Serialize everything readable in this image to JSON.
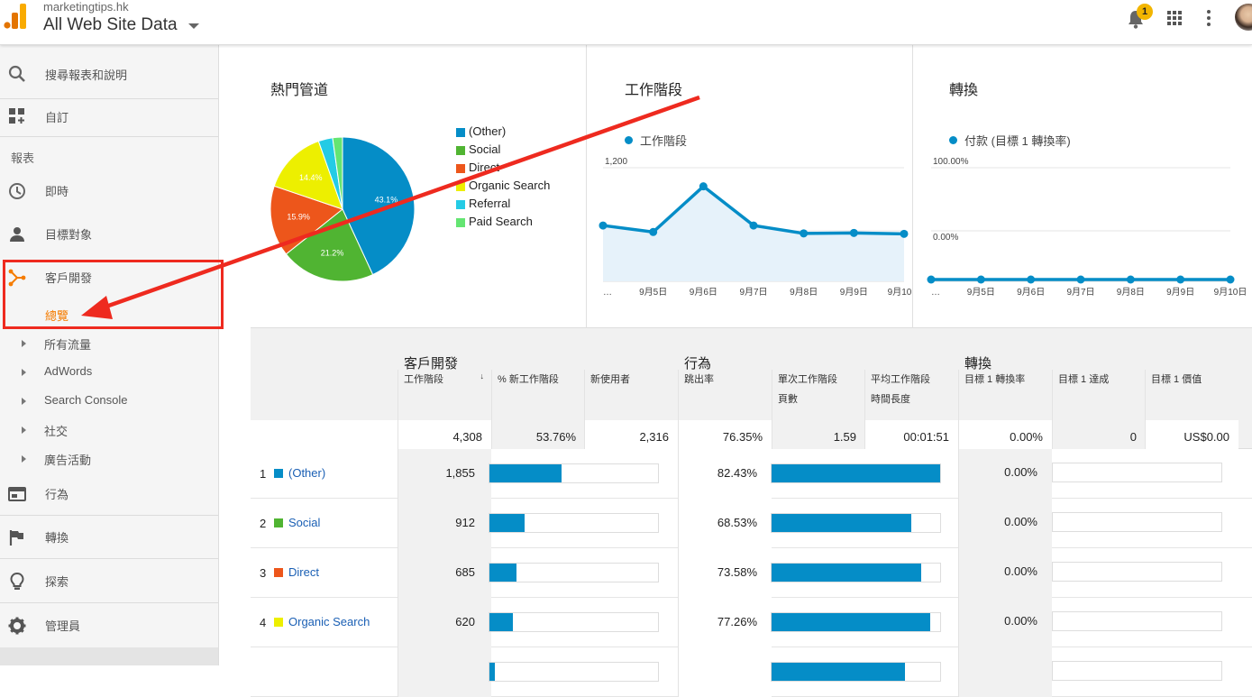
{
  "header": {
    "site_domain": "marketingtips.hk",
    "site_name": "All Web Site Data",
    "notification_count": "1"
  },
  "sidebar": {
    "search_placeholder": "搜尋報表和說明",
    "custom_label": "自訂",
    "section_label": "報表",
    "items": [
      {
        "label": "即時",
        "icon": "clock-icon"
      },
      {
        "label": "目標對象",
        "icon": "person-icon"
      },
      {
        "label": "客戶開發",
        "icon": "acquisition-icon"
      }
    ],
    "active_sub": "總覽",
    "subitems": [
      "所有流量",
      "AdWords",
      "Search Console",
      "社交",
      "廣告活動"
    ],
    "bottom_items": [
      {
        "label": "行為",
        "icon": "behavior-icon"
      },
      {
        "label": "轉換",
        "icon": "flag-icon"
      },
      {
        "label": "探索",
        "icon": "lightbulb-icon"
      },
      {
        "label": "管理員",
        "icon": "gear-icon"
      }
    ]
  },
  "cards": {
    "channels_title": "熱門管道",
    "sessions_title": "工作階段",
    "conversions_title": "轉換",
    "sessions_legend": "工作階段",
    "conversions_legend": "付款 (目標 1 轉換率)"
  },
  "chart_data": [
    {
      "type": "pie",
      "title": "熱門管道",
      "categories": [
        "(Other)",
        "Social",
        "Direct",
        "Organic Search",
        "Referral",
        "Paid Search"
      ],
      "values": [
        43.1,
        21.2,
        15.9,
        14.4,
        3.2,
        2.2
      ],
      "labels": [
        "43.1%",
        "21.2%",
        "15.9%",
        "14.4%",
        "",
        ""
      ],
      "colors": [
        "#058dc7",
        "#50b432",
        "#ed561b",
        "#edef00",
        "#24cbe5",
        "#64e572"
      ],
      "legend": "right"
    },
    {
      "type": "area",
      "title": "工作階段",
      "x": [
        "…",
        "9月5日",
        "9月6日",
        "9月7日",
        "9月8日",
        "9月9日",
        "9月10日"
      ],
      "series": [
        {
          "name": "工作階段",
          "values": [
            580,
            510,
            1000,
            580,
            495,
            500,
            490
          ]
        }
      ],
      "yticks": [
        "1,200",
        "600"
      ],
      "ylim": [
        0,
        1200
      ]
    },
    {
      "type": "line",
      "title": "轉換",
      "x": [
        "…",
        "9月5日",
        "9月6日",
        "9月7日",
        "9月8日",
        "9月9日",
        "9月10日"
      ],
      "series": [
        {
          "name": "付款 (目標 1 轉換率)",
          "values": [
            0,
            0,
            0,
            0,
            0,
            0,
            0
          ]
        }
      ],
      "yticks": [
        "100.00%",
        "0.00%"
      ],
      "ylim": [
        0,
        100
      ]
    }
  ],
  "table": {
    "groups": [
      "客戶開發",
      "行為",
      "轉換"
    ],
    "columns": [
      "工作階段",
      "% 新工作階段",
      "新使用者",
      "跳出率",
      "單次工作階段\n頁數",
      "平均工作階段\n時間長度",
      "目標 1 轉換率",
      "目標 1 達成",
      "目標 1 價值"
    ],
    "totals": [
      "4,308",
      "53.76%",
      "2,316",
      "76.35%",
      "1.59",
      "00:01:51",
      "0.00%",
      "0",
      "US$0.00"
    ],
    "rows": [
      {
        "num": "1",
        "name": "(Other)",
        "color": "#058dc7",
        "sessions": "1,855",
        "sessions_ratio": 0.43,
        "bounce": "82.43%",
        "bounce_ratio": 1.0,
        "conv": "0.00%"
      },
      {
        "num": "2",
        "name": "Social",
        "color": "#50b432",
        "sessions": "912",
        "sessions_ratio": 0.21,
        "bounce": "68.53%",
        "bounce_ratio": 0.83,
        "conv": "0.00%"
      },
      {
        "num": "3",
        "name": "Direct",
        "color": "#ed561b",
        "sessions": "685",
        "sessions_ratio": 0.16,
        "bounce": "73.58%",
        "bounce_ratio": 0.89,
        "conv": "0.00%"
      },
      {
        "num": "4",
        "name": "Organic Search",
        "color": "#edef00",
        "sessions": "620",
        "sessions_ratio": 0.14,
        "bounce": "77.26%",
        "bounce_ratio": 0.94,
        "conv": "0.00%"
      },
      {
        "num": "",
        "name": "",
        "color": "",
        "sessions": "",
        "sessions_ratio": 0.03,
        "bounce": "",
        "bounce_ratio": 0.79,
        "conv": ""
      }
    ]
  },
  "colors": {
    "accent": "#f57c00",
    "series": "#058dc7",
    "annotation": "#ee2a1f"
  }
}
